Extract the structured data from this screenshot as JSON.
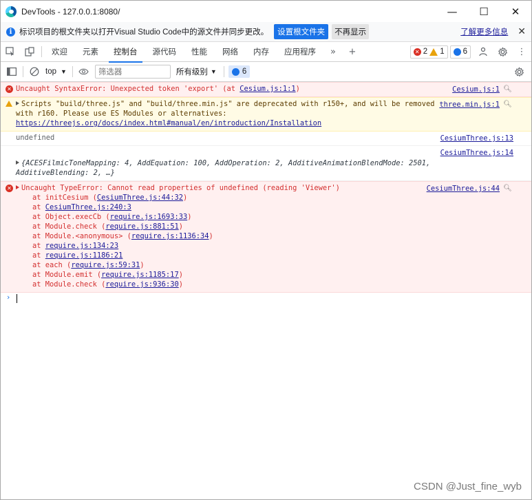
{
  "window": {
    "title": "DevTools - 127.0.0.1:8080/",
    "controls": {
      "minimize": "—",
      "maximize": "☐",
      "close": "✕"
    }
  },
  "infobar": {
    "text": "标识项目的根文件夹以打开Visual Studio Code中的源文件并同步更改。",
    "primary_button": "设置根文件夹",
    "secondary_button": "不再显示",
    "learn_more": "了解更多信息",
    "close": "✕"
  },
  "tabs": [
    {
      "label": "欢迎"
    },
    {
      "label": "元素"
    },
    {
      "label": "控制台"
    },
    {
      "label": "源代码"
    },
    {
      "label": "性能"
    },
    {
      "label": "网络"
    },
    {
      "label": "内存"
    },
    {
      "label": "应用程序"
    }
  ],
  "tab_more": "»",
  "tab_add": "+",
  "counts": {
    "errors": "2",
    "warnings": "1",
    "issues": "6"
  },
  "console_toolbar": {
    "context": "top",
    "filter_placeholder": "筛选器",
    "levels": "所有级别",
    "issues_count": "6"
  },
  "messages": [
    {
      "type": "error",
      "prefix": "Uncaught SyntaxError: Unexpected token 'export' (at ",
      "link": "Cesium.js:1:1",
      "suffix": ")",
      "source": "Cesium.js:1"
    },
    {
      "type": "warn",
      "text_a": "Scripts \"build/three.js\" and \"build/three.min.js\" are deprecated with r150+, and will be removed with r160. Please use ES Modules or alternatives: ",
      "link": "https://threejs.org/docs/index.html#manual/en/introduction/Installation",
      "source": "three.min.js:1"
    },
    {
      "type": "plain",
      "text": "undefined",
      "source": "CesiumThree.js:13"
    },
    {
      "type": "plain",
      "text": "{ACESFilmicToneMapping: 4, AddEquation: 100, AddOperation: 2, AdditiveAnimationBlendMode: 2501, AdditiveBlending: 2, …}",
      "source": "CesiumThree.js:14"
    },
    {
      "type": "error",
      "text": "Uncaught TypeError: Cannot read properties of undefined (reading 'Viewer')",
      "source": "CesiumThree.js:44",
      "stack": [
        {
          "pre": "at initCesium (",
          "link": "CesiumThree.js:44:32",
          "post": ")"
        },
        {
          "pre": "at ",
          "link": "CesiumThree.js:240:3",
          "post": ""
        },
        {
          "pre": "at Object.execCb (",
          "link": "require.js:1693:33",
          "post": ")"
        },
        {
          "pre": "at Module.check (",
          "link": "require.js:881:51",
          "post": ")"
        },
        {
          "pre": "at Module.<anonymous> (",
          "link": "require.js:1136:34",
          "post": ")"
        },
        {
          "pre": "at ",
          "link": "require.js:134:23",
          "post": ""
        },
        {
          "pre": "at ",
          "link": "require.js:1186:21",
          "post": ""
        },
        {
          "pre": "at each (",
          "link": "require.js:59:31",
          "post": ")"
        },
        {
          "pre": "at Module.emit (",
          "link": "require.js:1185:17",
          "post": ")"
        },
        {
          "pre": "at Module.check (",
          "link": "require.js:936:30",
          "post": ")"
        }
      ]
    }
  ],
  "prompt_symbol": "›",
  "watermark": "CSDN @Just_fine_wyb",
  "colors": {
    "accent": "#1a73e8",
    "error": "#d93025",
    "warning": "#e8a20c",
    "error_bg": "#fff0f0",
    "warning_bg": "#fffbe5"
  }
}
